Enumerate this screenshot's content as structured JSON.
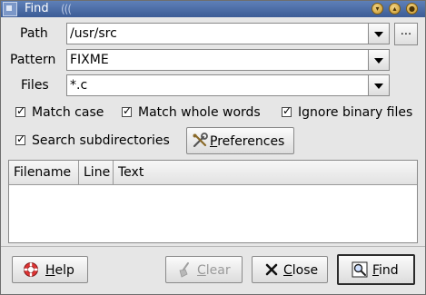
{
  "window": {
    "title": "Find",
    "grip": "((("
  },
  "form": {
    "path_label": "Path",
    "path_value": "/usr/src",
    "browse_label": "...",
    "pattern_label": "Pattern",
    "pattern_value": "FIXME",
    "files_label": "Files",
    "files_value": "*.c"
  },
  "options": {
    "match_case": {
      "label": "Match case",
      "checked": true
    },
    "match_whole_words": {
      "label": "Match whole words",
      "checked": true
    },
    "ignore_binary_files": {
      "label": "Ignore binary files",
      "checked": true
    },
    "search_subdirectories": {
      "label": "Search subdirectories",
      "checked": true
    },
    "preferences_label": "Preferences"
  },
  "results": {
    "columns": [
      "Filename",
      "Line",
      "Text"
    ]
  },
  "buttons": {
    "help": "Help",
    "clear": "Clear",
    "close": "Close",
    "find": "Find"
  }
}
